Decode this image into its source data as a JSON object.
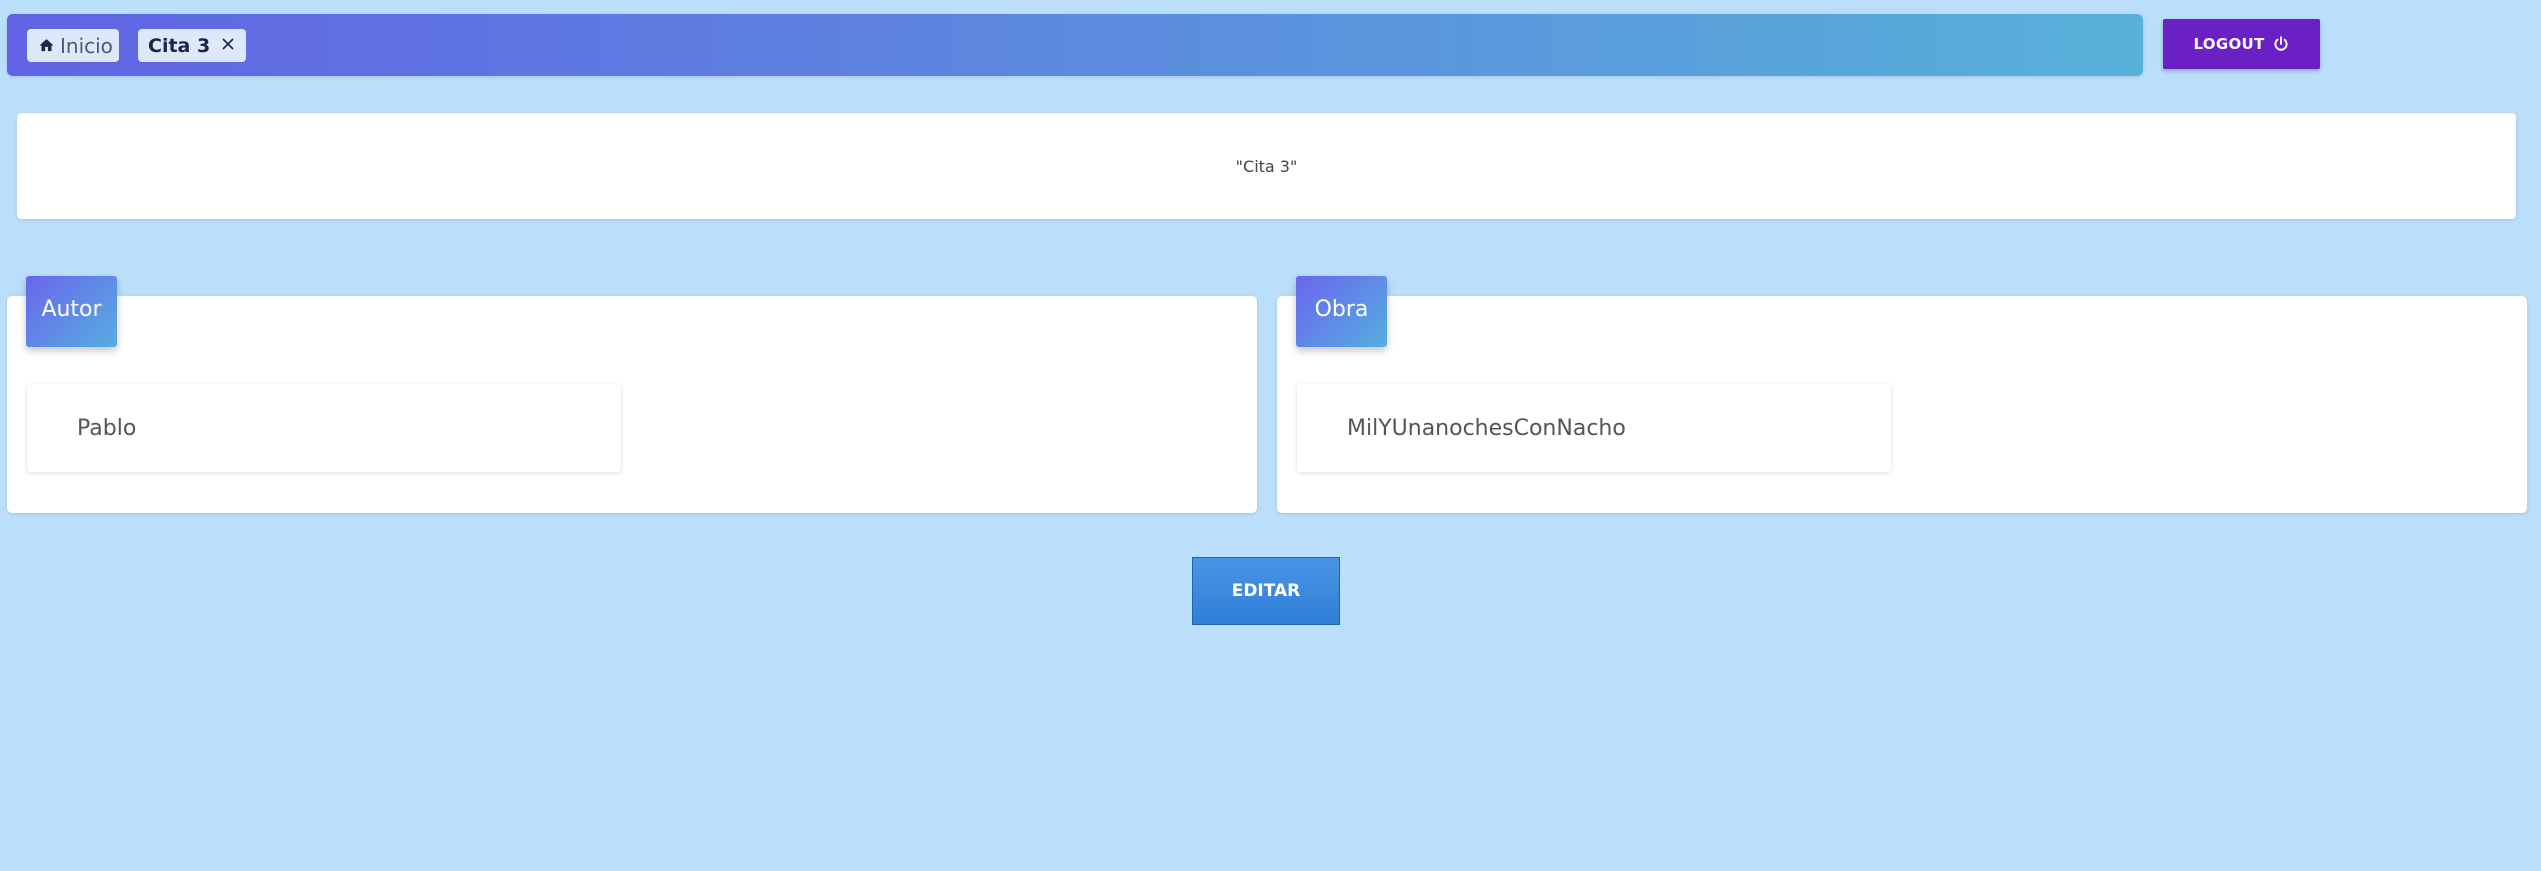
{
  "tabs": {
    "home_label": "Inicio",
    "home_icon": "home-icon",
    "active_label": "Cita 3",
    "close_icon": "close-icon"
  },
  "logout": {
    "label": "LOGOUT",
    "icon": "power-icon"
  },
  "quote": {
    "text": "\"Cita 3\""
  },
  "autor_card": {
    "title": "Autor",
    "value": "Pablo"
  },
  "obra_card": {
    "title": "Obra",
    "value": "MilYUnanochesConNacho"
  },
  "actions": {
    "edit_label": "EDITAR"
  },
  "colors": {
    "background": "#bbdefb",
    "topbar_start": "#6163e4",
    "topbar_end": "#57b1d9",
    "logout": "#6a20c5",
    "edit": "#3a88de"
  }
}
